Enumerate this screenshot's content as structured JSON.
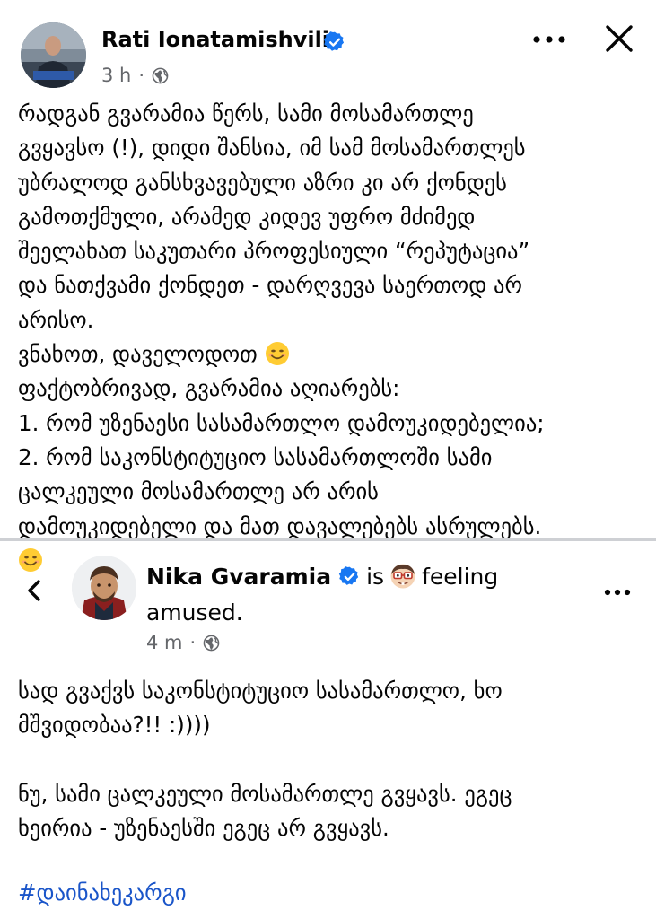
{
  "post": {
    "author": "Rati Ionatamishvili",
    "time": "3 h",
    "separator": "·",
    "lines": [
      "რადგან გვარამია წერს, სამი მოსამართლე",
      "გვყავსო (!), დიდი შანსია, იმ სამ მოსამართლეს",
      "უბრალოდ განსხვავებული აზრი კი არ ქონდეს",
      "გამოთქმული, არამედ კიდევ უფრო მძიმედ",
      "შეელახათ საკუთარი პროფესიული “რეპუტაცია”",
      "და ნათქვამი ქონდეთ - დარღვევა საერთოდ არ",
      "არისო.",
      "ვნახოთ, დაველოდოთ",
      "ფაქტობრივად, გვარამია აღიარებს:",
      "1. რომ უზენაესი სასამართლო დამოუკიდებელია;",
      "2. რომ საკონსტიტუციო სასამართლოში სამი",
      "ცალკეული მოსამართლე არ არის",
      "დამოუკიდებელი და მათ დავალებებს ასრულებს."
    ]
  },
  "shared": {
    "author": "Nika Gvaramia",
    "is_word": "is",
    "feeling_word": "feeling",
    "feeling": "amused.",
    "time": "4 m",
    "separator": "·",
    "lines": [
      "სად გვაქვს საკონსტიტუციო სასამართლო, ხო",
      "მშვიდობაა?!! :))))"
    ],
    "lines2": [
      "ნუ, სამი ცალკეული მოსამართლე გვყავს. ეგეც",
      "ხეირია - უზენაესში ეგეც არ გვყავს."
    ],
    "hashtag": "#დაინახეკარგი"
  },
  "icons": {
    "verified": "verified-badge-icon",
    "globe": "globe-icon",
    "more": "more-horizontal-icon",
    "close": "close-icon",
    "back": "chevron-left-icon",
    "smile": "smiling-face-emoji",
    "feeling": "nerd-face-emoji"
  },
  "colors": {
    "verified": "#1877f2",
    "meta": "#65676b",
    "hashtag": "#1a55c9",
    "divider": "#ced0d4",
    "text": "#050505"
  }
}
